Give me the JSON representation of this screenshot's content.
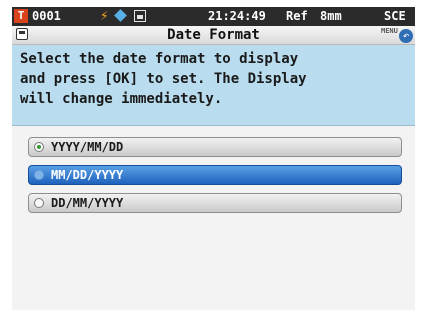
{
  "status_bar": {
    "sample_number": "0001",
    "time": "21:24:49",
    "measurement": "Ref",
    "aperture": "8mm",
    "mode": "SCE"
  },
  "title_bar": {
    "title": "Date Format",
    "menu_label": "MENU",
    "back_icon": "back-arrow-icon"
  },
  "instructions": {
    "text": "Select the date format to display\nand press [OK] to set. The Display\nwill change immediately."
  },
  "options": [
    {
      "label": "YYYY/MM/DD",
      "checked": true,
      "focused": false
    },
    {
      "label": "MM/DD/YYYY",
      "checked": false,
      "focused": true
    },
    {
      "label": "DD/MM/YYYY",
      "checked": false,
      "focused": false
    }
  ],
  "colors": {
    "highlight": "#1f62bd",
    "instruction_bg": "#b9dcef",
    "status_bar_bg": "#2b2b2b"
  }
}
